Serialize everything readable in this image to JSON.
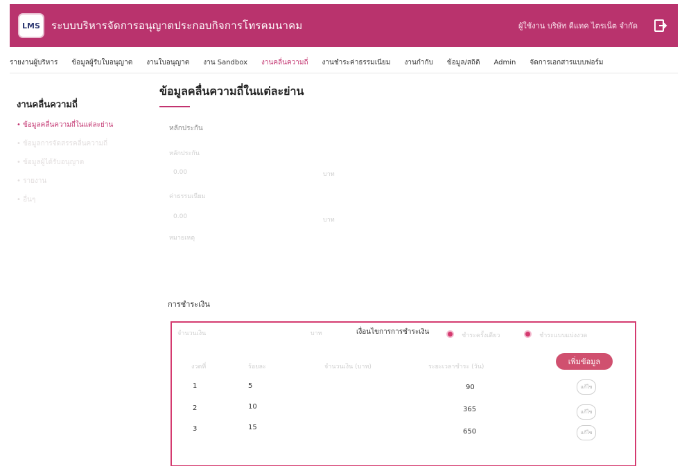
{
  "header": {
    "logo_text": "LMS",
    "title": "ระบบบริหารจัดการอนุญาตประกอบกิจการโทรคมนาคม",
    "user": "ผู้ใช้งาน บริษัท ดีแทค ไตรเน็ต จำกัด"
  },
  "nav": {
    "items": [
      "รายงานผู้บริหาร",
      "ข้อมูลผู้รับใบอนุญาต",
      "งานใบอนุญาต",
      "งาน Sandbox",
      "งานคลื่นความถี่",
      "งานชำระค่าธรรมเนียม",
      "งานกำกับ",
      "ข้อมูล/สถิติ",
      "Admin",
      "จัดการเอกสารแบบฟอร์ม"
    ]
  },
  "sidebar": {
    "heading": "งานคลื่นความถี่",
    "items": [
      "• ข้อมูลคลื่นความถี่ในแต่ละย่าน",
      "• ข้อมูลการจัดสรรคลื่นความถี่",
      "• ข้อมูลผู้ได้รับอนุญาต",
      "• รายงาน",
      "• อื่นๆ"
    ]
  },
  "main": {
    "title": "ข้อมูลคลื่นความถี่ในแต่ละย่าน",
    "guarantee_heading": "หลักประกัน",
    "field1_label": "หลักประกัน",
    "field1_value": "0.00",
    "field1_unit": "บาท",
    "field2_label": "ค่าธรรมเนียม",
    "field2_value": "0.00",
    "field2_unit": "บาท",
    "field3_label": "หมายเหตุ",
    "payment_heading": "การชำระเงิน",
    "payment": {
      "total_label": "จำนวนเงิน",
      "total_unit": "บาท",
      "condition_label": "เงื่อนไขการการชำระเงิน",
      "radio1": "ชำระครั้งเดียว",
      "radio2": "ชำระแบบแบ่งงวด",
      "add_button": "เพิ่มข้อมูล",
      "columns": [
        "งวดที่",
        "ร้อยละ",
        "จำนวนเงิน (บาท)",
        "ระยะเวลาชำระ (วัน)",
        ""
      ],
      "rows": [
        {
          "no": "1",
          "percent": "5",
          "days": "90",
          "action": "แก้ไข"
        },
        {
          "no": "2",
          "percent": "10",
          "days": "365",
          "action": "แก้ไข"
        },
        {
          "no": "3",
          "percent": "15",
          "days": "650",
          "action": "แก้ไข"
        }
      ]
    }
  },
  "colors": {
    "brand": "#b9336d",
    "accent": "#d43a6f"
  },
  "icons": {
    "logout": "logout-icon"
  }
}
